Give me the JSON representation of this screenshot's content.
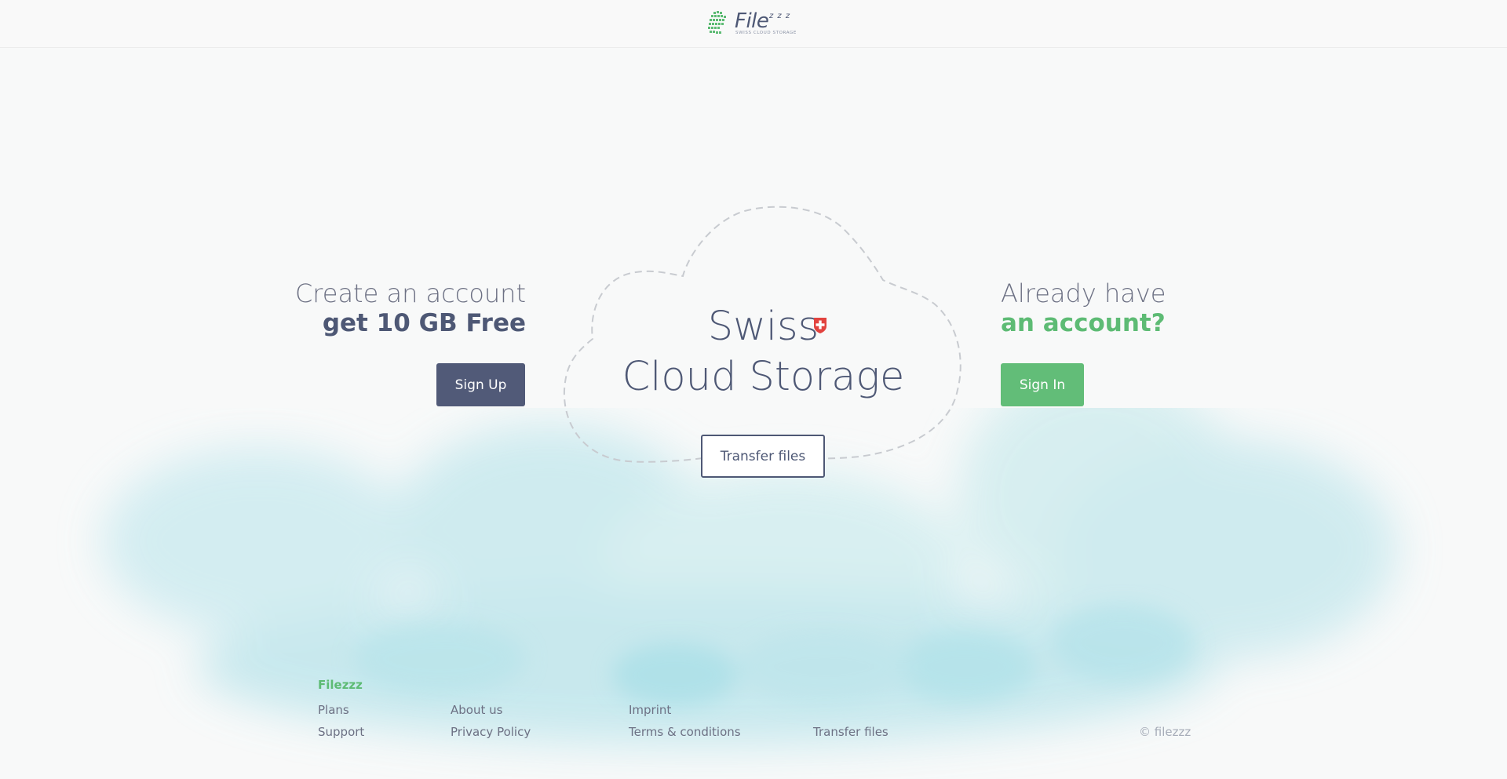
{
  "header": {
    "logo_word": "File",
    "logo_z": "z z z",
    "logo_tagline": "SWISS CLOUD STORAGE"
  },
  "hero_left": {
    "line1": "Create an account",
    "line2": "get 10 GB Free",
    "button": "Sign Up"
  },
  "hero_center": {
    "title_line1": "Swiss",
    "title_line2": "Cloud Storage",
    "button": "Transfer files"
  },
  "hero_right": {
    "line1": "Already have",
    "line2": "an account?",
    "button": "Sign In"
  },
  "footer": {
    "brand": "Filezzz",
    "links": {
      "plans": "Plans",
      "support": "Support",
      "about": "About us",
      "privacy": "Privacy Policy",
      "imprint": "Imprint",
      "terms": "Terms & conditions",
      "transfer": "Transfer files"
    },
    "copyright": "© filezzz"
  },
  "colors": {
    "brand_dark": "#515a78",
    "brand_green": "#62bd78",
    "swiss_red": "#e2433f",
    "background": "#f8f9f9"
  },
  "icons": {
    "logo": "filezzz-logo-icon",
    "flag": "swiss-flag-icon",
    "cloud": "cloud-outline-icon"
  }
}
